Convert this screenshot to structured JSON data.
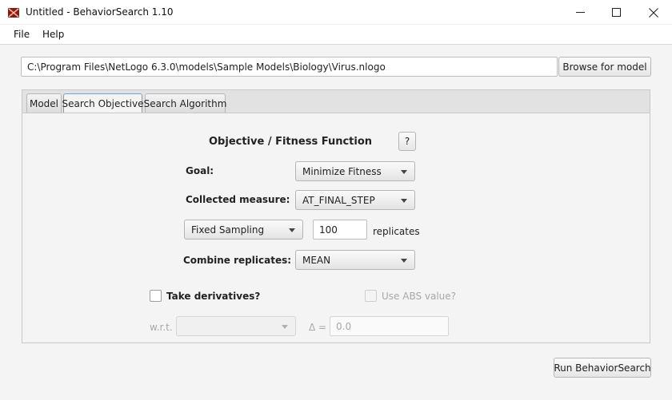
{
  "window": {
    "title": "Untitled - BehaviorSearch 1.10",
    "app_icon": "behaviorsearch-logo-icon",
    "controls": [
      "minimize-icon",
      "maximize-icon",
      "close-icon"
    ]
  },
  "menu": {
    "items": [
      {
        "label": "File"
      },
      {
        "label": "Help"
      }
    ]
  },
  "model": {
    "path": "C:\\Program Files\\NetLogo 6.3.0\\models\\Sample Models\\Biology\\Virus.nlogo",
    "browse_label": "Browse for model"
  },
  "tabs": [
    {
      "label": "Model",
      "active": false
    },
    {
      "label": "Search Objective",
      "active": true
    },
    {
      "label": "Search Algorithm",
      "active": false
    }
  ],
  "objective": {
    "title": "Objective / Fitness Function",
    "help_label": "?",
    "goal": {
      "label": "Goal:",
      "value": "Minimize Fitness"
    },
    "collected_measure": {
      "label": "Collected measure:",
      "value": "AT_FINAL_STEP"
    },
    "sampling": {
      "value": "Fixed Sampling",
      "replicates": "100",
      "replicates_label": "replicates"
    },
    "combine": {
      "label": "Combine replicates:",
      "value": "MEAN"
    },
    "derivatives": {
      "label": "Take derivatives?",
      "checked": false
    },
    "abs": {
      "label": "Use ABS value?",
      "checked": false,
      "enabled": false
    },
    "wrt": {
      "label": "w.r.t.",
      "value": ""
    },
    "delta": {
      "label": "Δ =",
      "value": "0.0"
    }
  },
  "run_label": "Run BehaviorSearch",
  "colors": {
    "active_tab_border": "#6fa3d4",
    "close_icon": "#222222",
    "logo_red": "#c0392b"
  }
}
